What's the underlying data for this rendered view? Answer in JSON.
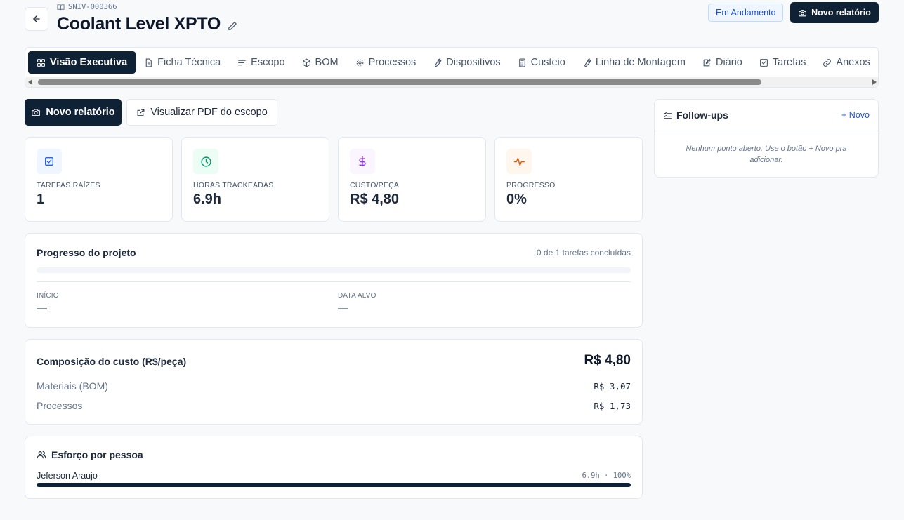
{
  "header": {
    "code": "SNIV-000366",
    "title": "Coolant Level XPTO",
    "status": "Em Andamento",
    "report_button": "Novo relatório"
  },
  "tabs": [
    {
      "label": "Visão Executiva",
      "icon": "grid-icon",
      "active": true
    },
    {
      "label": "Ficha Técnica",
      "icon": "document-icon"
    },
    {
      "label": "Escopo",
      "icon": "align-left-icon"
    },
    {
      "label": "BOM",
      "icon": "box-icon"
    },
    {
      "label": "Processos",
      "icon": "gear-icon"
    },
    {
      "label": "Dispositivos",
      "icon": "wrench-icon"
    },
    {
      "label": "Custeio",
      "icon": "calculator-icon"
    },
    {
      "label": "Linha de Montagem",
      "icon": "wrench-icon"
    },
    {
      "label": "Diário",
      "icon": "edit-icon"
    },
    {
      "label": "Tarefas",
      "icon": "checkbox-icon"
    },
    {
      "label": "Anexos",
      "icon": "link-icon"
    }
  ],
  "actions": {
    "new_report": "Novo relatório",
    "view_pdf": "Visualizar PDF do escopo"
  },
  "stats": [
    {
      "label": "TAREFAS RAÍZES",
      "value": "1",
      "icon": "check-square-icon",
      "color": "#2563eb",
      "bg": "#eff6ff"
    },
    {
      "label": "HORAS TRACKEADAS",
      "value": "6.9h",
      "icon": "clock-icon",
      "color": "#059669",
      "bg": "#ecfdf5"
    },
    {
      "label": "CUSTO/PEÇA",
      "value": "R$ 4,80",
      "icon": "dollar-icon",
      "color": "#9333ea",
      "bg": "#faf5ff"
    },
    {
      "label": "PROGRESSO",
      "value": "0%",
      "icon": "activity-icon",
      "color": "#ea580c",
      "bg": "#fff7ed"
    }
  ],
  "progress": {
    "title": "Progresso do projeto",
    "summary": "0 de 1 tarefas concluídas",
    "fraction": 0,
    "start_label": "INÍCIO",
    "start_value": "—",
    "target_label": "DATA ALVO",
    "target_value": "—"
  },
  "cost": {
    "title": "Composição do custo (R$/peça)",
    "total": "R$ 4,80",
    "rows": [
      {
        "label": "Materiais (BOM)",
        "value": "R$ 3,07"
      },
      {
        "label": "Processos",
        "value": "R$ 1,73"
      }
    ]
  },
  "effort": {
    "title": "Esforço por pessoa",
    "people": [
      {
        "name": "Jeferson Araujo",
        "value": "6.9h · 100%",
        "fraction": 1.0
      }
    ]
  },
  "followups": {
    "title": "Follow-ups",
    "new_label": "+ Novo",
    "empty": "Nenhum ponto aberto. Use o botão + Novo pra adicionar."
  }
}
